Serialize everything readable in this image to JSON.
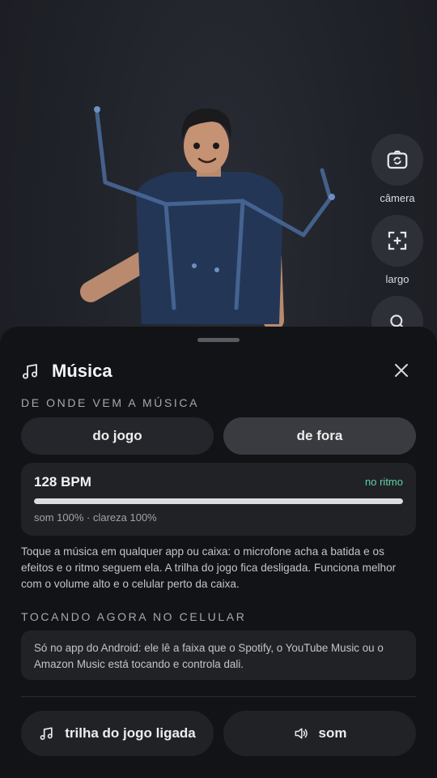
{
  "side_controls": [
    {
      "icon": "camera-switch-icon",
      "label": "câmera"
    },
    {
      "icon": "wide-angle-icon",
      "label": "largo"
    },
    {
      "icon": "search-icon",
      "label": ""
    }
  ],
  "sheet": {
    "title": "Música",
    "source_label": "DE ONDE VEM A MÚSICA",
    "source_options": [
      {
        "label": "do jogo",
        "selected": false
      },
      {
        "label": "de fora",
        "selected": true
      }
    ],
    "bpm": {
      "value": "128 BPM",
      "status": "no ritmo",
      "level": 1.0,
      "meta": "som 100% · clareza 100%"
    },
    "description": "Toque a música em qualquer app ou caixa: o microfone acha a batida e os efeitos e o ritmo seguem ela. A trilha do jogo fica desligada. Funciona melhor com o volume alto e o celular perto da caixa.",
    "now_playing_label": "TOCANDO AGORA NO CELULAR",
    "now_playing_info": "Só no app do Android: ele lê a faixa que o Spotify, o YouTube Music ou o Amazon Music está tocando e controla dali.",
    "footer": {
      "soundtrack_label": "trilha do jogo ligada",
      "sound_label": "som"
    }
  },
  "colors": {
    "sheet_bg": "#121316",
    "card_bg": "#212226",
    "accent_green": "#5ed3a8"
  }
}
